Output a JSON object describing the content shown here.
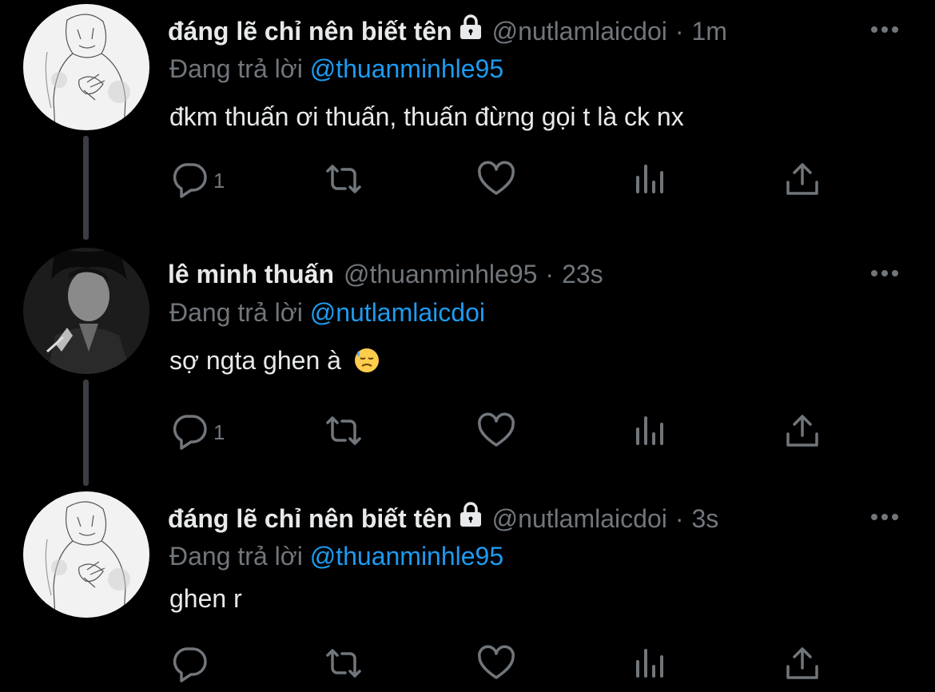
{
  "colors": {
    "background": "#000000",
    "name": "#e7e9ea",
    "muted": "#71767b",
    "mention": "#1d9bf0",
    "thread_line": "#3a3d41"
  },
  "tweets": [
    {
      "display_name": "đáng lẽ chỉ nên biết tên",
      "protected": true,
      "handle": "@nutlamlaicdoi",
      "separator": "·",
      "time": "1m",
      "replying_prefix": "Đang trả lời",
      "replying_to": "@thuanminhle95",
      "text": "đkm thuấn ơi thuấn, thuấn đừng gọi t là ck nx",
      "reply_count": "1",
      "avatar": "sketch-avatar"
    },
    {
      "display_name": "lê minh thuấn",
      "protected": false,
      "handle": "@thuanminhle95",
      "separator": "·",
      "time": "23s",
      "replying_prefix": "Đang trả lời",
      "replying_to": "@nutlamlaicdoi",
      "text": "sợ ngta ghen à",
      "emoji": "downcast-sweat-face",
      "reply_count": "1",
      "avatar": "photo-avatar"
    },
    {
      "display_name": "đáng lẽ chỉ nên biết tên",
      "protected": true,
      "handle": "@nutlamlaicdoi",
      "separator": "·",
      "time": "3s",
      "replying_prefix": "Đang trả lời",
      "replying_to": "@thuanminhle95",
      "text": "ghen r",
      "reply_count": "",
      "avatar": "sketch-avatar"
    }
  ],
  "icons": [
    "reply-icon",
    "retweet-icon",
    "like-icon",
    "analytics-icon",
    "share-icon",
    "more-icon",
    "lock-icon"
  ]
}
